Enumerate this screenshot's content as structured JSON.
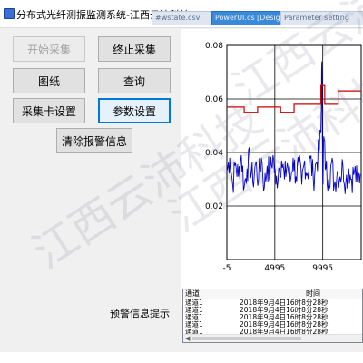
{
  "window": {
    "title": "分布式光纤测振监测系统-江西云沛科技"
  },
  "background_tabs": [
    "#wstate.csv",
    "PowerUI.cs [Design]",
    "Parameter setting"
  ],
  "buttons": {
    "start": "开始采集",
    "stop": "终止采集",
    "drawing": "图纸",
    "query": "查询",
    "card_settings": "采集卡设置",
    "params": "参数设置",
    "clear_alarm": "清除报警信息"
  },
  "alert_section": {
    "label": "预警信息提示",
    "columns": [
      "通道",
      "时间"
    ],
    "rows": [
      {
        "channel": "通道1",
        "time": "2018年9月4日16时8分28秒"
      },
      {
        "channel": "通道1",
        "time": "2018年9月4日16时8分28秒"
      },
      {
        "channel": "通道1",
        "time": "2018年9月4日16时8分28秒"
      },
      {
        "channel": "通道1",
        "time": "2018年9月4日16时8分28秒"
      },
      {
        "channel": "通道1",
        "time": "2018年9月4日16时8分28秒"
      }
    ]
  },
  "watermark": [
    "江西云沛科技",
    "江西云沛科技",
    "江西云沛科技"
  ],
  "colors": {
    "signal": "#0000cc",
    "threshold": "#cc0000",
    "axis": "#000000",
    "focus": "#0078d7"
  },
  "chart_data": {
    "type": "line",
    "title": "",
    "xlabel": "",
    "ylabel": "",
    "xlim": [
      -5,
      14000
    ],
    "ylim": [
      0.0,
      0.08
    ],
    "xticks": [
      -5,
      4995,
      9995
    ],
    "xtick_labels": [
      "-5",
      "4995",
      "9995"
    ],
    "yticks": [
      0.02,
      0.04,
      0.06,
      0.08
    ],
    "ytick_labels": [
      "0.02",
      "0.04",
      "0.06",
      "0.08"
    ],
    "grid": true,
    "series": [
      {
        "name": "",
        "color": "#0000cc",
        "x": [
          -5,
          300,
          600,
          900,
          1200,
          1500,
          1800,
          2100,
          2400,
          2700,
          3000,
          3300,
          3600,
          3900,
          4200,
          4500,
          4800,
          5100,
          5400,
          5700,
          6000,
          6300,
          6600,
          6900,
          7200,
          7500,
          7800,
          8100,
          8400,
          8700,
          9000,
          9300,
          9600,
          9800,
          9900,
          10000,
          10100,
          10300,
          10600,
          10900,
          11200,
          11500,
          11800,
          12100,
          12400,
          12700,
          13000,
          13300,
          13600,
          13900
        ],
        "values": [
          0.033,
          0.038,
          0.028,
          0.036,
          0.031,
          0.039,
          0.027,
          0.034,
          0.037,
          0.029,
          0.036,
          0.03,
          0.038,
          0.027,
          0.035,
          0.032,
          0.039,
          0.028,
          0.034,
          0.037,
          0.03,
          0.036,
          0.029,
          0.038,
          0.031,
          0.035,
          0.028,
          0.037,
          0.032,
          0.038,
          0.03,
          0.036,
          0.04,
          0.048,
          0.074,
          0.028,
          0.046,
          0.034,
          0.03,
          0.036,
          0.028,
          0.033,
          0.031,
          0.035,
          0.029,
          0.034,
          0.03,
          0.033,
          0.029,
          0.032
        ]
      },
      {
        "name": "",
        "color": "#cc0000",
        "step": true,
        "x": [
          -5,
          1800,
          3200,
          5600,
          7000,
          8200,
          9800,
          10200,
          11600,
          14000
        ],
        "values": [
          0.057,
          0.055,
          0.057,
          0.055,
          0.058,
          0.058,
          0.065,
          0.058,
          0.063,
          0.063
        ]
      }
    ]
  }
}
